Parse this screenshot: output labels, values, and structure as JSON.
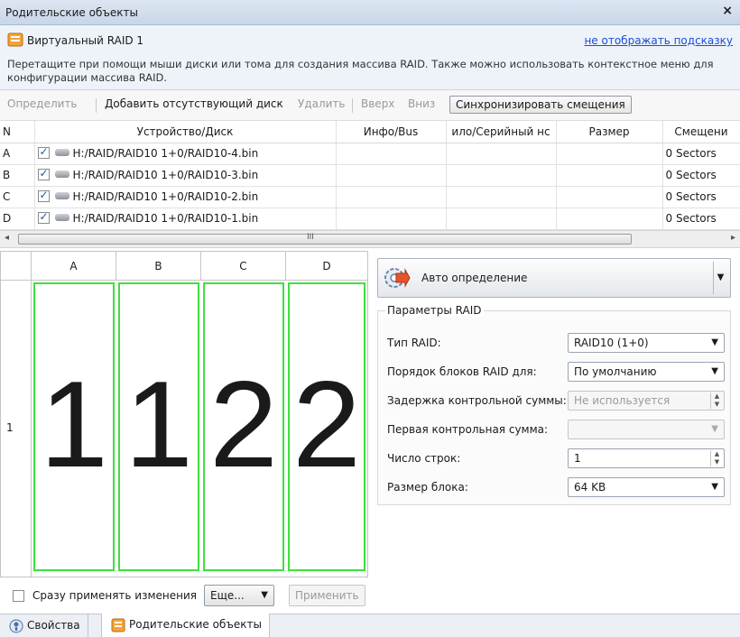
{
  "window": {
    "title": "Родительские объекты",
    "close": "×"
  },
  "hint": {
    "header": "Виртуальный RAID 1",
    "link": "не отображать подсказку",
    "description": "Перетащите при помощи мыши диски или тома для создания массива RAID. Также можно использовать контекстное меню для конфигурации массива RAID."
  },
  "toolbar": {
    "detect": "Определить",
    "add_missing": "Добавить отсутствующий диск",
    "delete": "Удалить",
    "up": "Вверх",
    "down": "Вниз",
    "sync_offsets": "Синхронизировать смещения"
  },
  "table": {
    "headers": [
      "N",
      "Устройство/Диск",
      "Инфо/Bus",
      "ило/Серийный нс",
      "Размер",
      "Смещени"
    ],
    "rows": [
      {
        "n": "A",
        "device": "H:/RAID/RAID10 1+0/RAID10-4.bin",
        "info": "",
        "serial": "",
        "size": "",
        "offset": "0 Sectors"
      },
      {
        "n": "B",
        "device": "H:/RAID/RAID10 1+0/RAID10-3.bin",
        "info": "",
        "serial": "",
        "size": "",
        "offset": "0 Sectors"
      },
      {
        "n": "C",
        "device": "H:/RAID/RAID10 1+0/RAID10-2.bin",
        "info": "",
        "serial": "",
        "size": "",
        "offset": "0 Sectors"
      },
      {
        "n": "D",
        "device": "H:/RAID/RAID10 1+0/RAID10-1.bin",
        "info": "",
        "serial": "",
        "size": "",
        "offset": "0 Sectors"
      }
    ]
  },
  "scrollbar": {
    "grip": "III"
  },
  "stripe_map": {
    "columns": [
      "A",
      "B",
      "C",
      "D"
    ],
    "row_label": "1",
    "blocks": [
      "1",
      "1",
      "2",
      "2"
    ]
  },
  "auto_detect": {
    "label": "Авто определение"
  },
  "params": {
    "legend": "Параметры RAID",
    "raid_type": {
      "label": "Тип RAID:",
      "value": "RAID10 (1+0)"
    },
    "block_order": {
      "label": "Порядок блоков RAID для:",
      "value": "По умолчанию"
    },
    "parity_delay": {
      "label": "Задержка контрольной суммы:",
      "value": "Не используется"
    },
    "first_parity": {
      "label": "Первая контрольная сумма:",
      "value": ""
    },
    "rows_count": {
      "label": "Число строк:",
      "value": "1"
    },
    "block_size": {
      "label": "Размер блока:",
      "value": "64 KB"
    }
  },
  "bottom": {
    "apply_immediately": "Сразу применять изменения",
    "more": "Еще...",
    "apply": "Применить"
  },
  "tabs": [
    {
      "label": "Свойства"
    },
    {
      "label": "Родительские объекты"
    }
  ],
  "colors": {
    "block_border": "#3ee03e",
    "link": "#1a4fd6"
  }
}
